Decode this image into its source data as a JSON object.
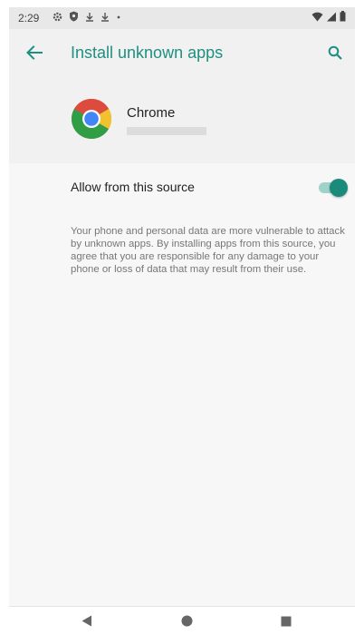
{
  "status_bar": {
    "time": "2:29",
    "icons": [
      "settings-icon",
      "shield-icon",
      "download-icon",
      "download-icon",
      "dot-icon",
      "wifi-icon",
      "signal-icon",
      "battery-icon"
    ]
  },
  "toolbar": {
    "title": "Install unknown apps",
    "back_icon": "arrow-back-icon",
    "search_icon": "search-icon"
  },
  "app": {
    "name": "Chrome",
    "icon": "chrome-icon"
  },
  "setting": {
    "label": "Allow from this source",
    "enabled": true
  },
  "warning_text": "Your phone and personal data are more vulnerable to attack by unknown apps. By installing apps from this source, you agree that you are responsible for any damage to your phone or loss of data that may result from their use.",
  "nav_bar": {
    "buttons": [
      "back-triangle-icon",
      "home-circle-icon",
      "recents-square-icon"
    ]
  },
  "colors": {
    "accent": "#1e8f80",
    "switch_track": "#9fd2c9",
    "switch_thumb": "#1a8a7b"
  }
}
